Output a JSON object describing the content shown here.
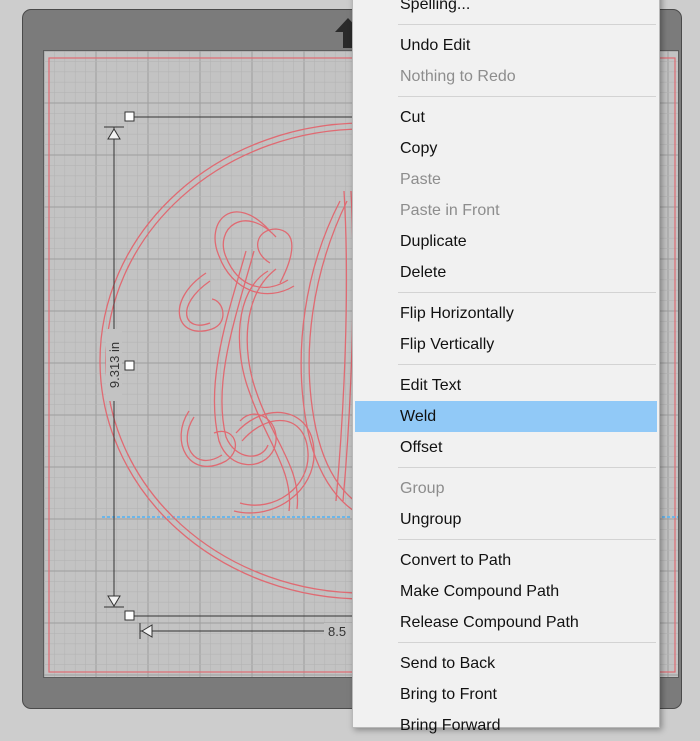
{
  "canvas": {
    "height_dimension_label": "9.313 in",
    "width_dimension_label": "8.5"
  },
  "menu": {
    "groups": [
      [
        {
          "label": "Spelling...",
          "enabled": true
        }
      ],
      [
        {
          "label": "Undo Edit",
          "enabled": true
        },
        {
          "label": "Nothing to Redo",
          "enabled": false
        }
      ],
      [
        {
          "label": "Cut",
          "enabled": true
        },
        {
          "label": "Copy",
          "enabled": true
        },
        {
          "label": "Paste",
          "enabled": false
        },
        {
          "label": "Paste in Front",
          "enabled": false
        },
        {
          "label": "Duplicate",
          "enabled": true
        },
        {
          "label": "Delete",
          "enabled": true
        }
      ],
      [
        {
          "label": "Flip Horizontally",
          "enabled": true
        },
        {
          "label": "Flip Vertically",
          "enabled": true
        }
      ],
      [
        {
          "label": "Edit Text",
          "enabled": true
        },
        {
          "label": "Weld",
          "enabled": true,
          "highlighted": true
        },
        {
          "label": "Offset",
          "enabled": true
        }
      ],
      [
        {
          "label": "Group",
          "enabled": false
        },
        {
          "label": "Ungroup",
          "enabled": true
        }
      ],
      [
        {
          "label": "Convert to Path",
          "enabled": true
        },
        {
          "label": "Make Compound Path",
          "enabled": true
        },
        {
          "label": "Release Compound Path",
          "enabled": true
        }
      ],
      [
        {
          "label": "Send to Back",
          "enabled": true
        },
        {
          "label": "Bring to Front",
          "enabled": true
        },
        {
          "label": "Bring Forward",
          "enabled": true
        }
      ]
    ]
  },
  "colors": {
    "cut_line": "#e06a72",
    "selection_highlight": "#91c9f7",
    "guide_line": "#6ab6ea"
  }
}
